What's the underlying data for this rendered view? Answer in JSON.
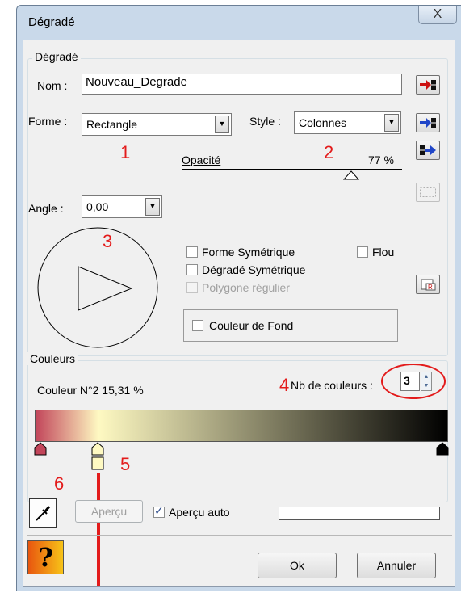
{
  "window": {
    "title": "Dégradé",
    "close_glyph": "X"
  },
  "degrade_group": {
    "label": "Dégradé",
    "nom_label": "Nom :",
    "nom_value": "Nouveau_Degrade",
    "forme_label": "Forme :",
    "forme_value": "Rectangle",
    "style_label": "Style :",
    "style_value": "Colonnes",
    "opacite_label": "Opacité",
    "opacite_value": "77 %",
    "opacity_level": 0.77,
    "angle_label": "Angle :",
    "angle_value": "0,00",
    "forme_symetrique_label": "Forme Symétrique",
    "flou_label": "Flou",
    "degrade_symetrique_label": "Dégradé Symétrique",
    "polygone_label": "Polygone régulier",
    "couleur_fond_label": "Couleur de Fond"
  },
  "couleurs_group": {
    "label": "Couleurs",
    "couleur_info": "Couleur N°2 15,31 %",
    "nb_couleurs_label": "Nb de couleurs :",
    "nb_couleurs_value": "3",
    "gradient_colors": [
      "#c2455a",
      "#fef9c2",
      "#000000"
    ],
    "stop_positions": [
      0.0,
      0.1531,
      1.0
    ]
  },
  "bottom": {
    "apercu_label": "Aperçu",
    "apercu_auto_label": "Aperçu auto",
    "ok_label": "Ok",
    "annuler_label": "Annuler",
    "help_glyph": "?"
  },
  "annotations": [
    "1",
    "2",
    "3",
    "4",
    "5",
    "6"
  ],
  "colors": {
    "annotation_red": "#e31b1b",
    "window_frame": "#c9d9ea",
    "dialog_face": "#f0f0f0"
  }
}
